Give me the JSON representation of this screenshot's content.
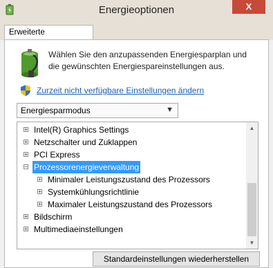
{
  "window": {
    "title": "Energieoptionen",
    "close_glyph": "X",
    "app_icon": "power-options-icon"
  },
  "tabs": [
    {
      "label": "Erweiterte Einstellungen"
    }
  ],
  "intro": {
    "text": "Wählen Sie den anzupassenden Energiesparplan und die gewünschten Energiespareinstellungen aus.",
    "icon": "battery-icon"
  },
  "link": {
    "label": "Zurzeit nicht verfügbare Einstellungen ändern",
    "icon": "uac-shield-icon"
  },
  "plan_select": {
    "value": "Energiesparmodus"
  },
  "tree": {
    "items": [
      {
        "label": "Intel(R) Graphics Settings",
        "expander": "+",
        "level": 0
      },
      {
        "label": "Netzschalter und Zuklappen",
        "expander": "+",
        "level": 0
      },
      {
        "label": "PCI Express",
        "expander": "+",
        "level": 0
      },
      {
        "label": "Prozessorenergieverwaltung",
        "expander": "−",
        "level": 0,
        "selected": true
      },
      {
        "label": "Minimaler Leistungszustand des Prozessors",
        "expander": "+",
        "level": 1
      },
      {
        "label": "Systemkühlungsrichtlinie",
        "expander": "+",
        "level": 1
      },
      {
        "label": "Maximaler Leistungszustand des Prozessors",
        "expander": "+",
        "level": 1
      },
      {
        "label": "Bildschirm",
        "expander": "+",
        "level": 0
      },
      {
        "label": "Multimediaeinstellungen",
        "expander": "+",
        "level": 0
      }
    ]
  },
  "buttons": {
    "restore": "Standardeinstellungen wiederherstellen"
  },
  "colors": {
    "selection": "#3399ff",
    "close": "#c7493a",
    "link": "#1e5fb4"
  }
}
